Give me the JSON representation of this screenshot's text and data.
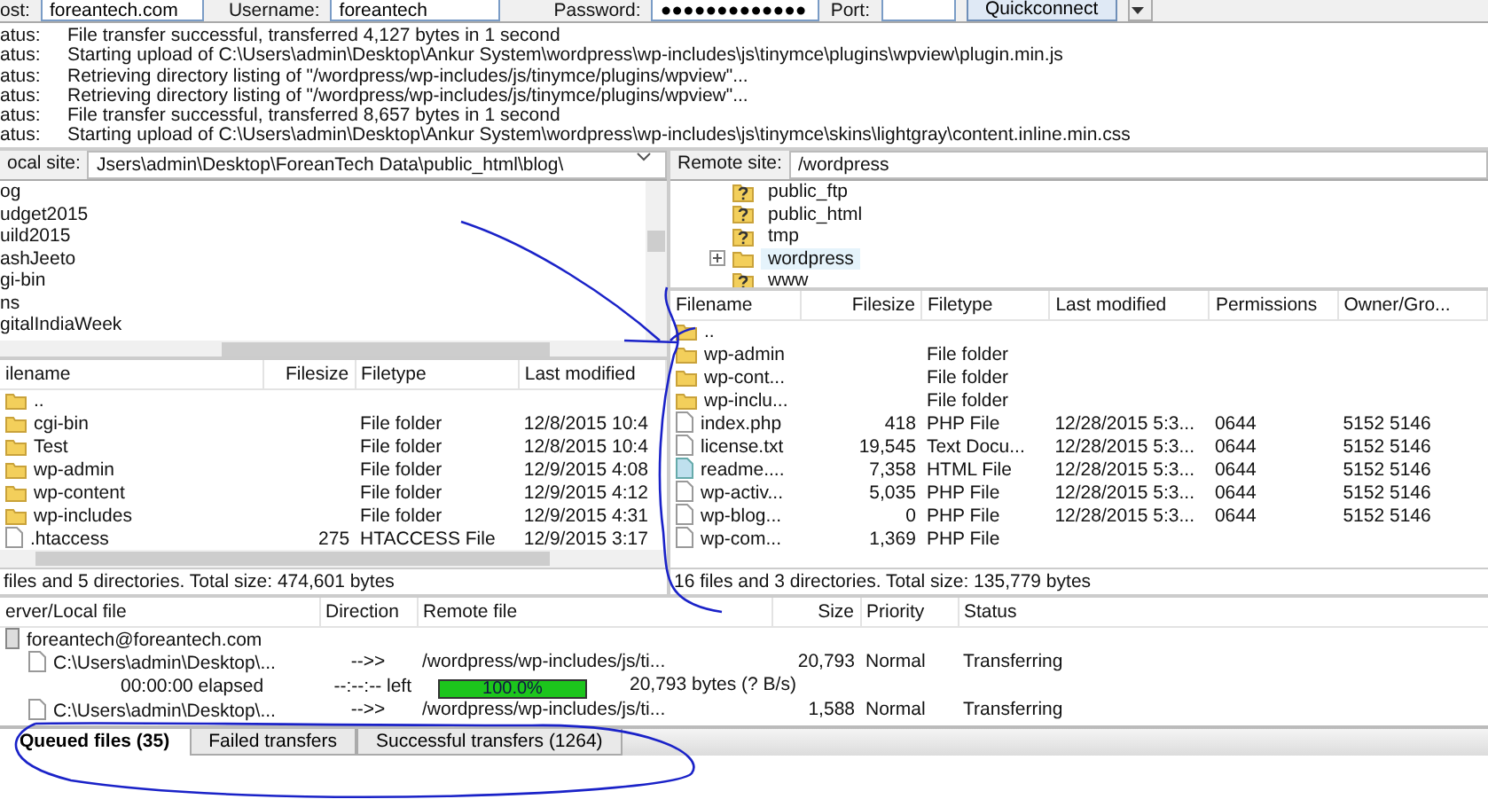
{
  "quickconnect": {
    "host_label": "ost:",
    "host": "foreantech.com",
    "username_label": "Username:",
    "username": "foreantech",
    "password_label": "Password:",
    "password": "●●●●●●●●●●●●●",
    "port_label": "Port:",
    "button": "Quickconnect"
  },
  "log": [
    {
      "label": "atus:",
      "message": "File transfer successful, transferred 4,127 bytes in 1 second"
    },
    {
      "label": "atus:",
      "message": "Starting upload of C:\\Users\\admin\\Desktop\\Ankur System\\wordpress\\wp-includes\\js\\tinymce\\plugins\\wpview\\plugin.min.js"
    },
    {
      "label": "atus:",
      "message": "Retrieving directory listing of \"/wordpress/wp-includes/js/tinymce/plugins/wpview\"..."
    },
    {
      "label": "atus:",
      "message": "Retrieving directory listing of \"/wordpress/wp-includes/js/tinymce/plugins/wpview\"..."
    },
    {
      "label": "atus:",
      "message": "File transfer successful, transferred 8,657 bytes in 1 second"
    },
    {
      "label": "atus:",
      "message": "Starting upload of C:\\Users\\admin\\Desktop\\Ankur System\\wordpress\\wp-includes\\js\\tinymce\\skins\\lightgray\\content.inline.min.css"
    }
  ],
  "local": {
    "site_label": "ocal site:",
    "path": "Jsers\\admin\\Desktop\\ForeanTech Data\\public_html\\blog\\",
    "tree": [
      "og",
      "udget2015",
      "uild2015",
      "ashJeeto",
      "gi-bin",
      "ns",
      "gitalIndiaWeek"
    ],
    "columns": [
      "ilename",
      "Filesize",
      "Filetype",
      "Last modified"
    ],
    "rows": [
      {
        "kind": "folder",
        "name": ".."
      },
      {
        "kind": "folder",
        "name": "cgi-bin",
        "type": "File folder",
        "modified": "12/8/2015 10:4"
      },
      {
        "kind": "folder",
        "name": "Test",
        "type": "File folder",
        "modified": "12/8/2015 10:4"
      },
      {
        "kind": "folder",
        "name": "wp-admin",
        "type": "File folder",
        "modified": "12/9/2015 4:08"
      },
      {
        "kind": "folder",
        "name": "wp-content",
        "type": "File folder",
        "modified": "12/9/2015 4:12"
      },
      {
        "kind": "folder",
        "name": "wp-includes",
        "type": "File folder",
        "modified": "12/9/2015 4:31"
      },
      {
        "kind": "file",
        "name": ".htaccess",
        "size": "275",
        "type": "HTACCESS File",
        "modified": "12/9/2015 3:17"
      }
    ],
    "summary": "files and 5 directories. Total size: 474,601 bytes"
  },
  "remote": {
    "site_label": "Remote site:",
    "path": "/wordpress",
    "tree": [
      {
        "kind": "unknown",
        "name": "public_ftp",
        "expandable": false,
        "selected": false
      },
      {
        "kind": "unknown",
        "name": "public_html",
        "expandable": false,
        "selected": false
      },
      {
        "kind": "unknown",
        "name": "tmp",
        "expandable": false,
        "selected": false
      },
      {
        "kind": "folder",
        "name": "wordpress",
        "expandable": true,
        "selected": true
      },
      {
        "kind": "unknown",
        "name": "www",
        "expandable": false,
        "selected": false
      }
    ],
    "columns": [
      "Filename",
      "Filesize",
      "Filetype",
      "Last modified",
      "Permissions",
      "Owner/Gro..."
    ],
    "rows": [
      {
        "kind": "folder",
        "name": ".."
      },
      {
        "kind": "folder",
        "name": "wp-admin",
        "type": "File folder"
      },
      {
        "kind": "folder",
        "name": "wp-cont...",
        "type": "File folder"
      },
      {
        "kind": "folder",
        "name": "wp-inclu...",
        "type": "File folder"
      },
      {
        "kind": "file",
        "name": "index.php",
        "size": "418",
        "type": "PHP File",
        "modified": "12/28/2015 5:3...",
        "perms": "0644",
        "owner": "5152 5146"
      },
      {
        "kind": "file",
        "name": "license.txt",
        "size": "19,545",
        "type": "Text Docu...",
        "modified": "12/28/2015 5:3...",
        "perms": "0644",
        "owner": "5152 5146"
      },
      {
        "kind": "html",
        "name": "readme....",
        "size": "7,358",
        "type": "HTML File",
        "modified": "12/28/2015 5:3...",
        "perms": "0644",
        "owner": "5152 5146"
      },
      {
        "kind": "file",
        "name": "wp-activ...",
        "size": "5,035",
        "type": "PHP File",
        "modified": "12/28/2015 5:3...",
        "perms": "0644",
        "owner": "5152 5146"
      },
      {
        "kind": "file",
        "name": "wp-blog...",
        "size": "0",
        "type": "PHP File",
        "modified": "12/28/2015 5:3...",
        "perms": "0644",
        "owner": "5152 5146"
      },
      {
        "kind": "file",
        "name": "wp-com...",
        "size": "1,369",
        "type": "PHP File"
      }
    ],
    "summary": "16 files and 3 directories. Total size: 135,779 bytes"
  },
  "queue": {
    "columns": [
      "erver/Local file",
      "Direction",
      "Remote file",
      "Size",
      "Priority",
      "Status"
    ],
    "items": [
      {
        "kind": "server",
        "local": "foreantech@foreantech.com"
      },
      {
        "kind": "file",
        "local": "C:\\Users\\admin\\Desktop\\...",
        "direction": "-->>",
        "remote": "/wordpress/wp-includes/js/ti...",
        "size": "20,793",
        "priority": "Normal",
        "status": "Transferring"
      },
      {
        "kind": "progress",
        "elapsed": "00:00:00 elapsed",
        "left": "--:--:-- left",
        "level": 1.0,
        "percent": "100.0%",
        "bytes": "20,793 bytes (? B/s)"
      },
      {
        "kind": "file",
        "local": "C:\\Users\\admin\\Desktop\\...",
        "direction": "-->>",
        "remote": "/wordpress/wp-includes/js/ti...",
        "size": "1,588",
        "priority": "Normal",
        "status": "Transferring"
      }
    ]
  },
  "tabs": [
    {
      "label": "Queued files (35)",
      "selected": true
    },
    {
      "label": "Failed transfers",
      "selected": false
    },
    {
      "label": "Successful transfers (1264)",
      "selected": false
    }
  ]
}
